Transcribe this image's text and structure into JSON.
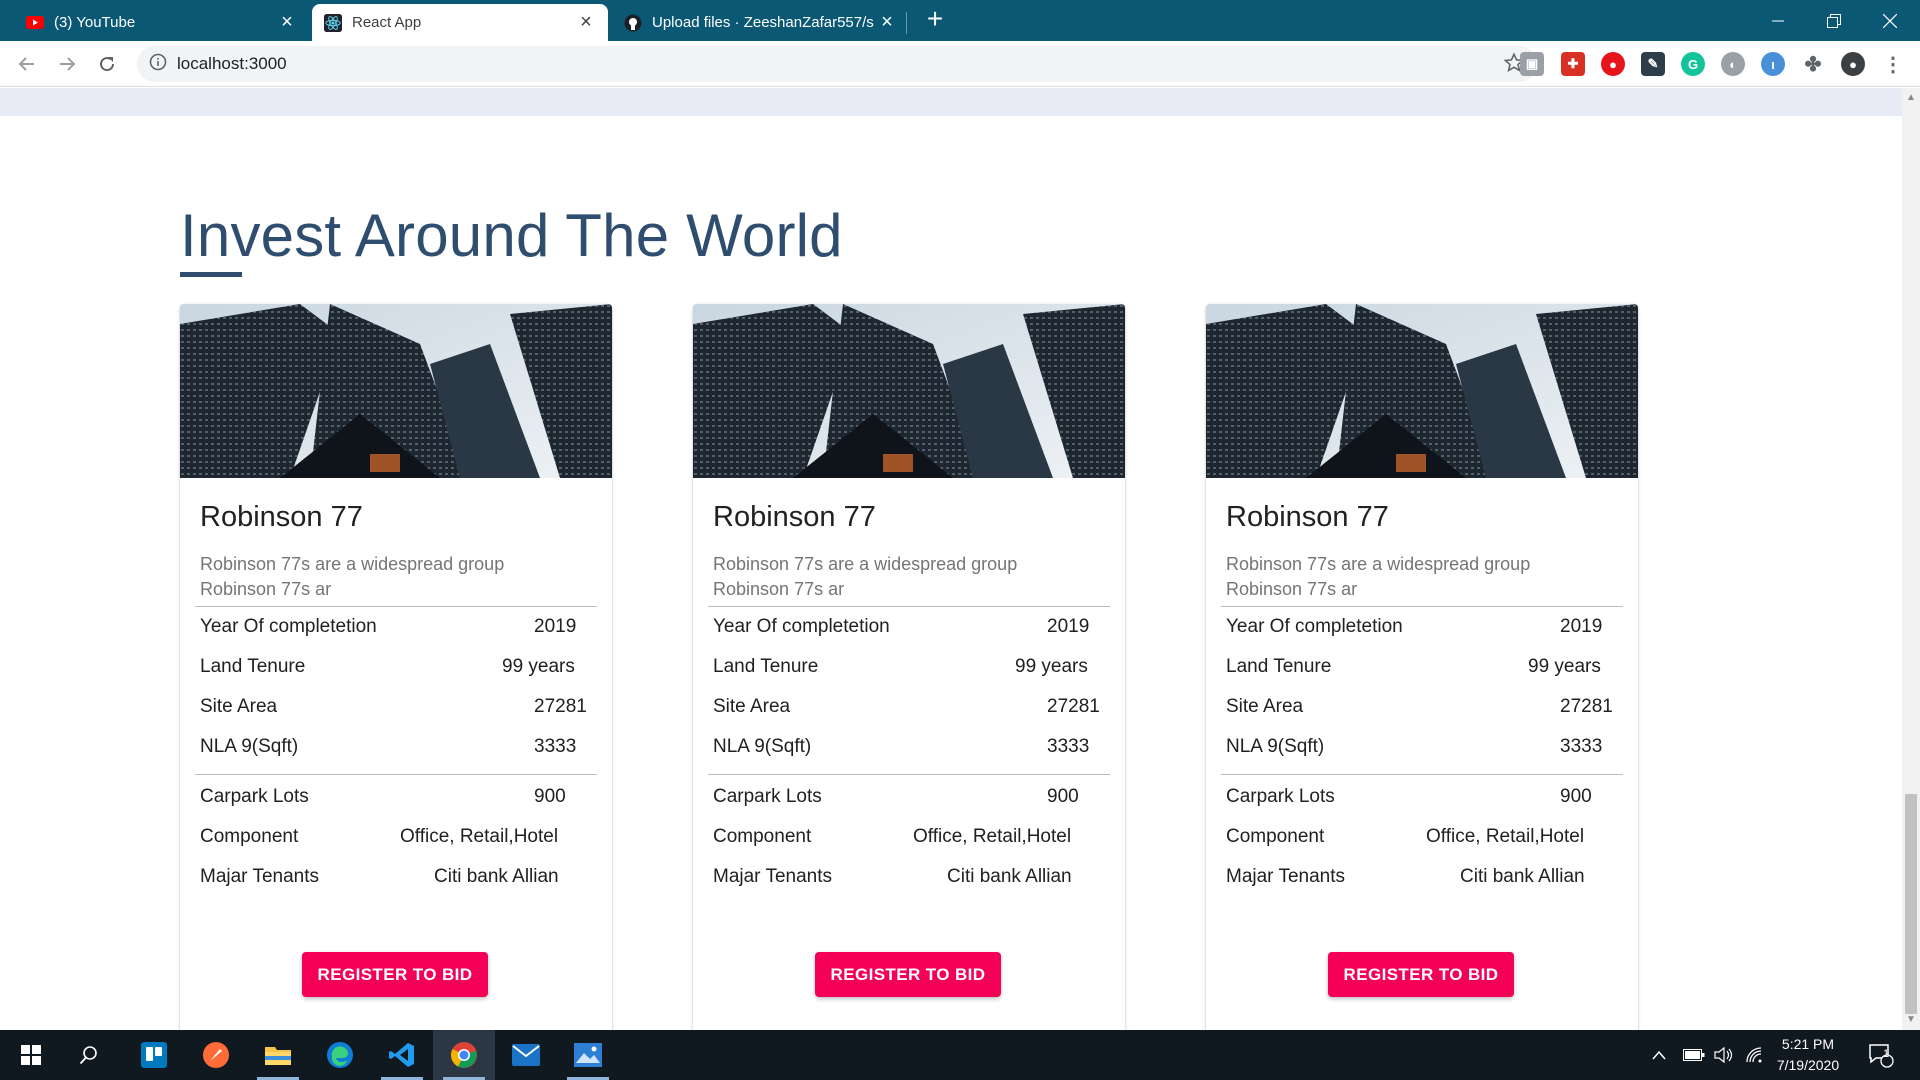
{
  "browser": {
    "tabs": [
      {
        "title": "(3) YouTube",
        "active": false,
        "icon": "youtube-icon"
      },
      {
        "title": "React App",
        "active": true,
        "icon": "react-icon"
      },
      {
        "title": "Upload files · ZeeshanZafar557/s",
        "active": false,
        "icon": "github-icon"
      }
    ],
    "url": "localhost:3000",
    "colors": {
      "tabstrip": "#0b5874",
      "accent": "#f50057",
      "heading": "#2f4d6e"
    }
  },
  "page": {
    "heading": "Invest Around The World",
    "cards": [
      {
        "title": "Robinson 77",
        "description": "Robinson 77s are a widespread group Robinson 77s ar",
        "details": [
          {
            "label": "Year Of completetion",
            "value": "2019"
          },
          {
            "label": "Land Tenure",
            "value": "99 years"
          },
          {
            "label": "Site Area",
            "value": "27281"
          },
          {
            "label": "NLA 9(Sqft)",
            "value": "3333"
          }
        ],
        "extra": [
          {
            "label": "Carpark Lots",
            "value": "900"
          },
          {
            "label": "Component",
            "value": "Office, Retail,Hotel"
          },
          {
            "label": "Majar Tenants",
            "value": "Citi bank Allian"
          }
        ],
        "button": "REGISTER TO BID"
      },
      {
        "title": "Robinson 77",
        "description": "Robinson 77s are a widespread group Robinson 77s ar",
        "details": [
          {
            "label": "Year Of completetion",
            "value": "2019"
          },
          {
            "label": "Land Tenure",
            "value": "99 years"
          },
          {
            "label": "Site Area",
            "value": "27281"
          },
          {
            "label": "NLA 9(Sqft)",
            "value": "3333"
          }
        ],
        "extra": [
          {
            "label": "Carpark Lots",
            "value": "900"
          },
          {
            "label": "Component",
            "value": "Office, Retail,Hotel"
          },
          {
            "label": "Majar Tenants",
            "value": "Citi bank Allian"
          }
        ],
        "button": "REGISTER TO BID"
      },
      {
        "title": "Robinson 77",
        "description": "Robinson 77s are a widespread group Robinson 77s ar",
        "details": [
          {
            "label": "Year Of completetion",
            "value": "2019"
          },
          {
            "label": "Land Tenure",
            "value": "99 years"
          },
          {
            "label": "Site Area",
            "value": "27281"
          },
          {
            "label": "NLA 9(Sqft)",
            "value": "3333"
          }
        ],
        "extra": [
          {
            "label": "Carpark Lots",
            "value": "900"
          },
          {
            "label": "Component",
            "value": "Office, Retail,Hotel"
          },
          {
            "label": "Majar Tenants",
            "value": "Citi bank Allian"
          }
        ],
        "button": "REGISTER TO BID"
      }
    ]
  },
  "taskbar": {
    "apps": [
      "start-icon",
      "search-icon",
      "trello-icon",
      "postman-icon",
      "file-explorer-icon",
      "edge-icon",
      "vscode-icon",
      "chrome-icon",
      "mail-icon",
      "photos-icon"
    ],
    "time": "5:21 PM",
    "date": "7/19/2020",
    "notifications": "1"
  }
}
